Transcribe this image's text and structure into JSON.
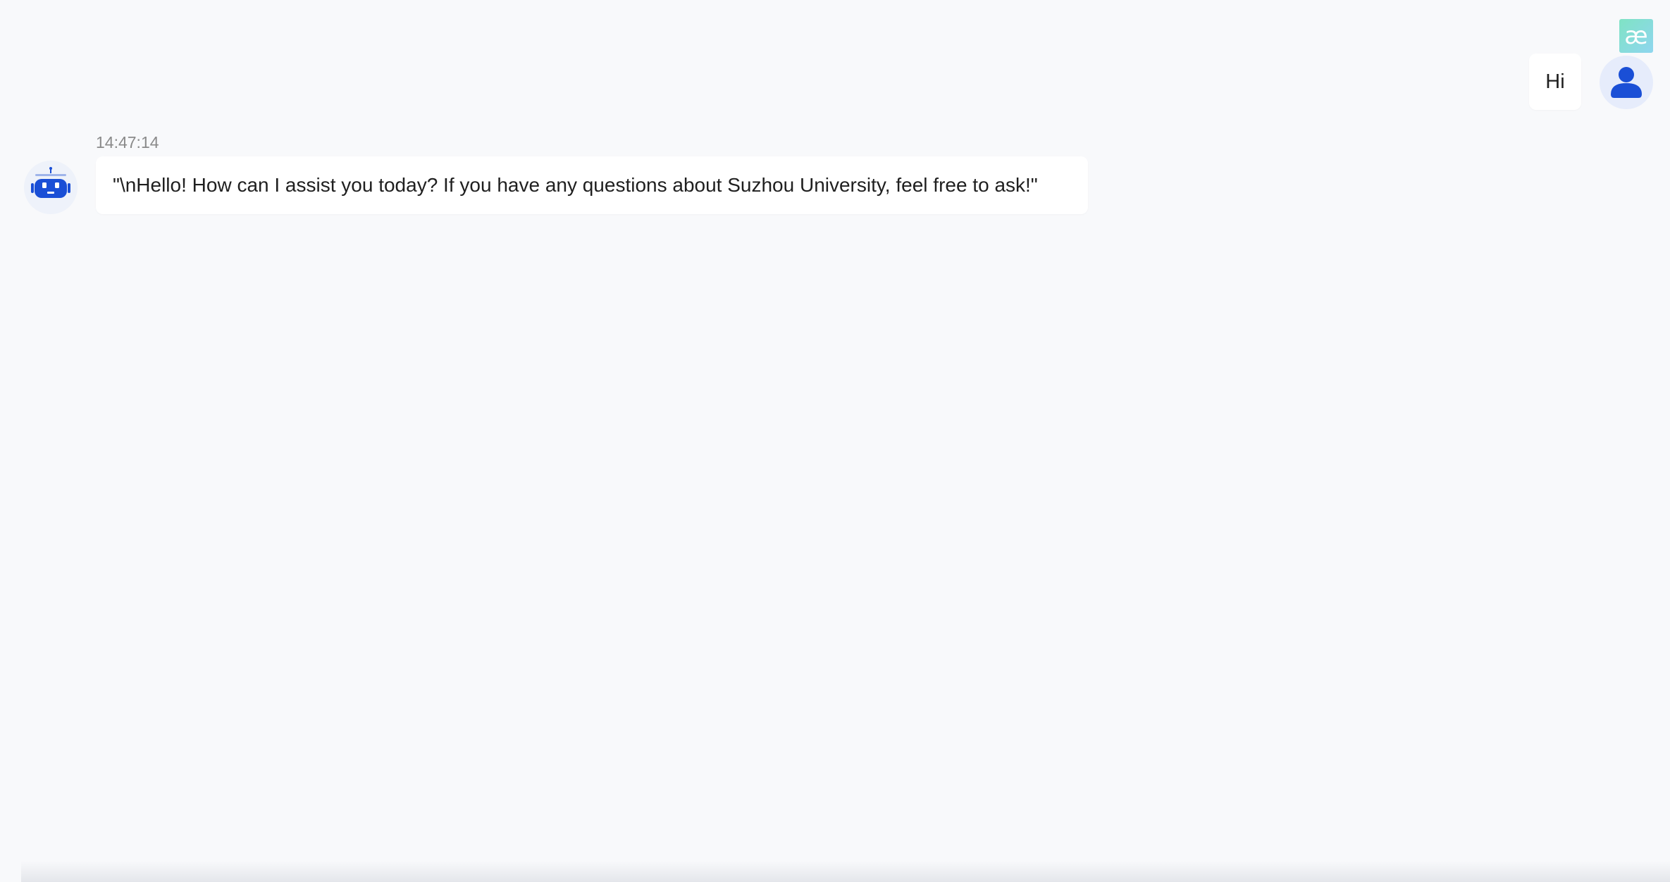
{
  "extension_badge": {
    "glyph": "æ",
    "icon": "extension-badge-icon"
  },
  "user_message": {
    "text": "Hi",
    "avatar_icon": "user-icon"
  },
  "bot_message": {
    "timestamp": "14:47:14",
    "text": "\"\\nHello! How can I assist you today? If you have any questions about Suzhou University, feel free to ask!\"",
    "avatar_icon": "robot-icon"
  },
  "colors": {
    "background": "#f8f9fb",
    "bubble": "#ffffff",
    "accent": "#1a4fd6",
    "badge": "#7fe3c4"
  }
}
